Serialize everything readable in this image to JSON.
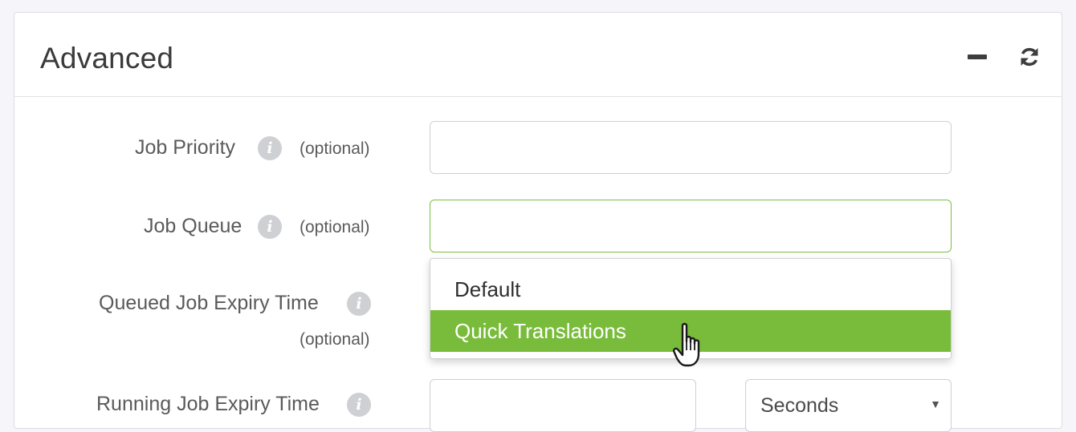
{
  "panel": {
    "title": "Advanced",
    "collapse_icon": "minus-icon",
    "refresh_icon": "refresh-icon"
  },
  "form": {
    "job_priority": {
      "label": "Job Priority",
      "info_icon": "info-icon",
      "info_glyph": "i",
      "optional": "(optional)",
      "value": ""
    },
    "job_queue": {
      "label": "Job Queue",
      "info_icon": "info-icon",
      "info_glyph": "i",
      "optional": "(optional)",
      "value": ""
    },
    "queued_expiry": {
      "label": "Queued Job Expiry Time",
      "info_icon": "info-icon",
      "info_glyph": "i",
      "optional": "(optional)"
    },
    "running_expiry": {
      "label": "Running Job Expiry Time",
      "info_icon": "info-icon",
      "info_glyph": "i",
      "unit_value": "Seconds"
    }
  },
  "dropdown": {
    "options": [
      "Default",
      "Quick Translations"
    ],
    "highlighted_index": 1
  },
  "colors": {
    "accent_green": "#79bb3b",
    "focus_border": "#79c043"
  }
}
